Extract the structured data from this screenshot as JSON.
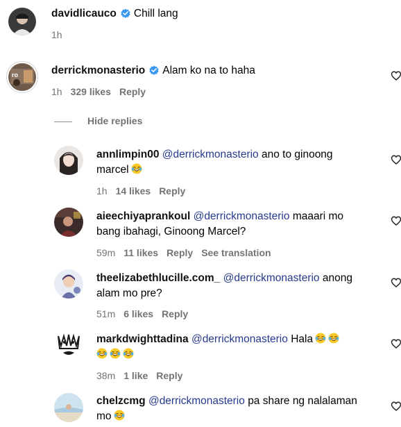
{
  "top_comment": {
    "username": "davidlicauco",
    "verified": true,
    "text": "Chill lang",
    "time": "1h"
  },
  "main_comment": {
    "username": "derrickmonasterio",
    "verified": true,
    "text": "Alam ko na to haha",
    "time": "1h",
    "likes": "329 likes",
    "reply_label": "Reply"
  },
  "hide_replies_label": "Hide replies",
  "replies": [
    {
      "username": "annlimpin00",
      "mention": "@derrickmonasterio",
      "text_line1": "ano to ginoong",
      "text_line2": "marcel",
      "emojis": 1,
      "time": "1h",
      "likes": "14 likes",
      "reply_label": "Reply"
    },
    {
      "username": "aieechiyaprankoul",
      "mention": "@derrickmonasterio",
      "text_line1": "maaari mo",
      "text_line2": "bang ibahagi, Ginoong Marcel?",
      "time": "59m",
      "likes": "11 likes",
      "reply_label": "Reply",
      "translation_label": "See translation"
    },
    {
      "username": "theelizabethlucille.com_",
      "mention": "@derrickmonasterio",
      "text_line1": "anong",
      "text_line2": "alam mo pre?",
      "time": "51m",
      "likes": "6 likes",
      "reply_label": "Reply"
    },
    {
      "username": "markdwighttadina",
      "mention": "@derrickmonasterio",
      "text_line1": "Hala",
      "line1_emojis": 2,
      "line2_emojis": 3,
      "time": "38m",
      "likes": "1 like",
      "reply_label": "Reply"
    },
    {
      "username": "chelzcmg",
      "mention": "@derrickmonasterio",
      "text_line1": "pa share ng nalalaman",
      "text_line2": "mo",
      "emojis": 1
    }
  ],
  "colors": {
    "mention": "#263a8d",
    "meta": "#737373",
    "verified": "#3897f0"
  },
  "icons": [
    "heart-icon",
    "verified-badge-icon",
    "laughing-emoji-icon"
  ]
}
